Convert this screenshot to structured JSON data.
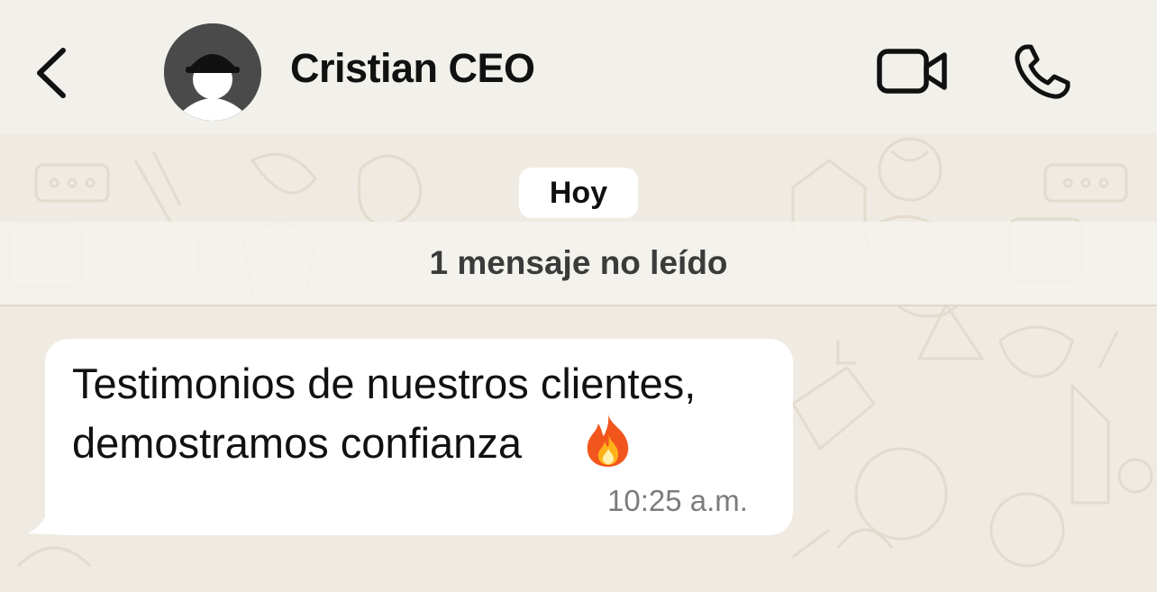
{
  "header": {
    "back_icon": "chevron-left-icon",
    "avatar_icon": "person-with-cap-avatar",
    "contact_name": "Cristian CEO",
    "video_icon": "video-camera-icon",
    "call_icon": "phone-icon"
  },
  "chat": {
    "date_separator": "Hoy",
    "unread_notice": "1 mensaje no leído",
    "messages": [
      {
        "direction": "incoming",
        "lines": [
          "Testimonios de nuestros clientes,",
          "demostramos confianza"
        ],
        "emoji": "fire-icon",
        "time": "10:25 a.m."
      }
    ]
  },
  "colors": {
    "wallpaper": "#efeae2",
    "header_bg": "#f2f0eb",
    "bubble_incoming": "#ffffff",
    "timestamp": "#7c7c7c"
  }
}
